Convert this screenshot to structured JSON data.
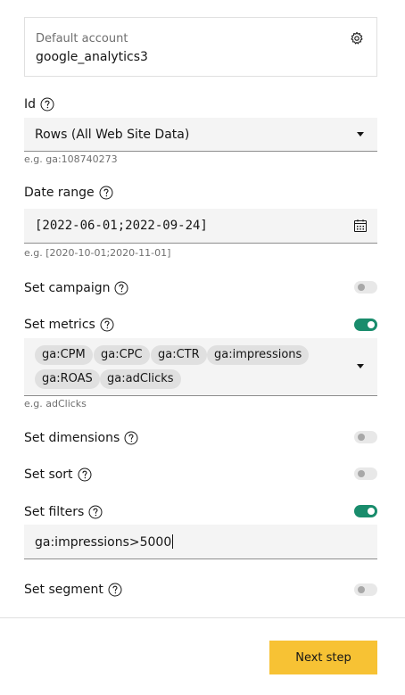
{
  "account": {
    "label": "Default account",
    "value": "google_analytics3",
    "icon": "gear-icon"
  },
  "id_field": {
    "label": "Id",
    "value": "Rows (All Web Site Data)",
    "hint": "e.g. ga:108740273"
  },
  "date_range": {
    "label": "Date range",
    "value": "[2022-06-01;2022-09-24]",
    "hint": "e.g. [2020-10-01;2020-11-01]",
    "icon": "calendar-icon"
  },
  "campaign": {
    "label": "Set campaign",
    "enabled": false
  },
  "metrics": {
    "label": "Set metrics",
    "enabled": true,
    "tags": [
      "ga:CPM",
      "ga:CPC",
      "ga:CTR",
      "ga:impressions",
      "ga:ROAS",
      "ga:adClicks"
    ],
    "hint": "e.g. adClicks"
  },
  "dimensions": {
    "label": "Set dimensions",
    "enabled": false
  },
  "sort": {
    "label": "Set sort",
    "enabled": false
  },
  "filters": {
    "label": "Set filters",
    "enabled": true,
    "value": "ga:impressions>5000"
  },
  "segment": {
    "label": "Set segment",
    "enabled": false
  },
  "footer": {
    "next_label": "Next step"
  },
  "colors": {
    "toggle_on": "#198c6c",
    "button": "#f7c234"
  }
}
